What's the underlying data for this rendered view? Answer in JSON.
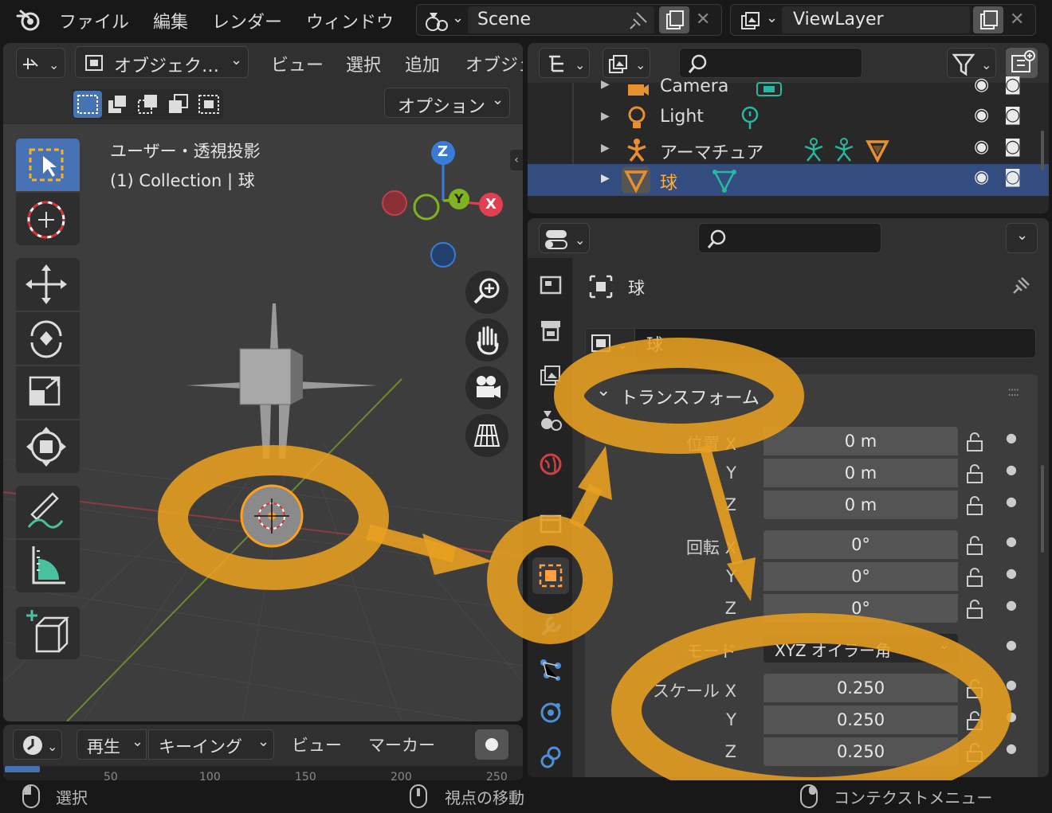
{
  "topbar": {
    "menus": [
      "ファイル",
      "編集",
      "レンダー",
      "ウィンドウ"
    ],
    "scene_label": "Scene",
    "viewlayer_label": "ViewLayer"
  },
  "viewport": {
    "mode_label": "オブジェク…",
    "menus": [
      "ビュー",
      "選択",
      "追加",
      "オブジェ"
    ],
    "options_label": "オプション",
    "view_name": "ユーザー・透視投影",
    "collection_info": "(1) Collection | 球",
    "gizmo_z": "Z",
    "gizmo_y": "Y",
    "gizmo_x": "X"
  },
  "timeline": {
    "play_label": "再生",
    "keying_label": "キーイング",
    "view_label": "ビュー",
    "marker_label": "マーカー",
    "ticks": [
      "50",
      "100",
      "150",
      "200",
      "250"
    ]
  },
  "outliner": {
    "items": [
      {
        "name": "Camera",
        "selected": false
      },
      {
        "name": "Light",
        "selected": false
      },
      {
        "name": "アーマチュア",
        "selected": false
      },
      {
        "name": "球",
        "selected": true
      }
    ]
  },
  "properties": {
    "object_name": "球",
    "name_field": "球",
    "transform_header": "トランスフォーム",
    "location_label": "位置 X",
    "location": [
      "0 m",
      "0 m",
      "0 m"
    ],
    "rotation_label": "回転 X",
    "rotation": [
      "0°",
      "0°",
      "0°"
    ],
    "mode_label": "モード",
    "mode_value": "XYZ オイラー角",
    "scale_label": "スケール X",
    "scale": [
      "0.250",
      "0.250",
      "0.250"
    ],
    "axis_y": "Y",
    "axis_z": "Z"
  },
  "statusbar": {
    "select": "選択",
    "move_view": "視点の移動",
    "context_menu": "コンテクストメニュー"
  },
  "colors": {
    "accent_orange": "#E8A020",
    "selection_blue": "#334D80",
    "axis_x": "#E0404F",
    "axis_y": "#7FB320",
    "axis_z": "#3A7BD5"
  }
}
